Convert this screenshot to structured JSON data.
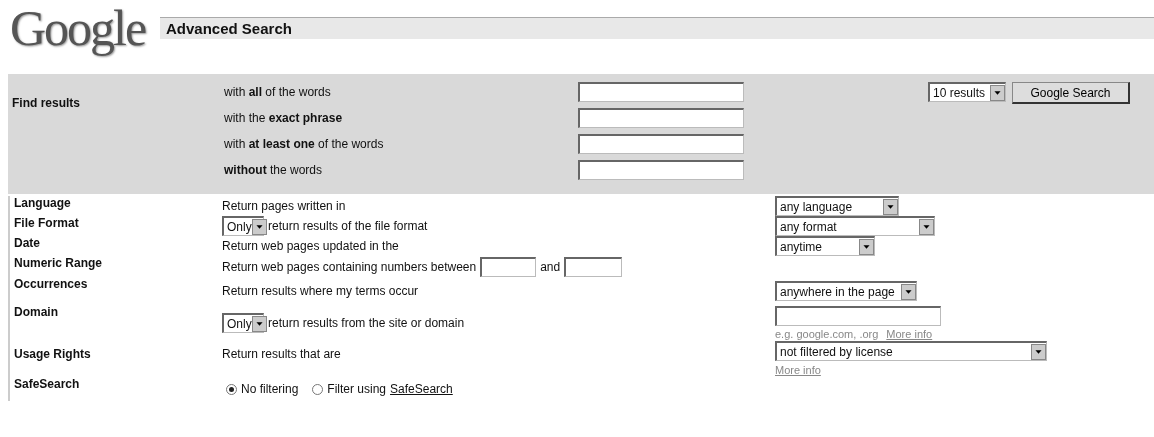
{
  "logo": "Google",
  "title": "Advanced Search",
  "find_results": {
    "label": "Find results",
    "rows": [
      {
        "text": "with **all** of the words"
      },
      {
        "text": "with the **exact phrase**"
      },
      {
        "text": "with **at least one** of the words"
      },
      {
        "text": "**without** the words"
      }
    ],
    "results_select": "10 results",
    "search_button": "Google Search"
  },
  "options": [
    {
      "kind": "select",
      "label": "Language",
      "description": "Return pages written in",
      "select": "any language"
    },
    {
      "kind": "prefixed_select",
      "label": "File Format",
      "prefix": "Only",
      "description": "return results of the file format",
      "select": "any format"
    },
    {
      "kind": "select",
      "label": "Date",
      "description": "Return web pages updated in the",
      "select": "anytime"
    },
    {
      "kind": "range",
      "label": "Numeric Range",
      "description": "Return web pages containing numbers between",
      "joiner": "and"
    },
    {
      "kind": "select",
      "label": "Occurrences",
      "description": "Return results where my terms occur",
      "select": "anywhere in the page"
    },
    {
      "kind": "domain",
      "label": "Domain",
      "prefix": "Only",
      "description": "return results from the site or domain",
      "hint": "e.g. google.com, .org",
      "link": "More info"
    },
    {
      "kind": "license",
      "label": "Usage Rights",
      "description": "Return results that are",
      "select": "not filtered by license",
      "link": "More info"
    },
    {
      "kind": "radio",
      "label": "SafeSearch",
      "choices": [
        {
          "label": "No filtering",
          "selected": true
        },
        {
          "label": "Filter using",
          "link": "SafeSearch",
          "selected": false
        }
      ]
    }
  ]
}
